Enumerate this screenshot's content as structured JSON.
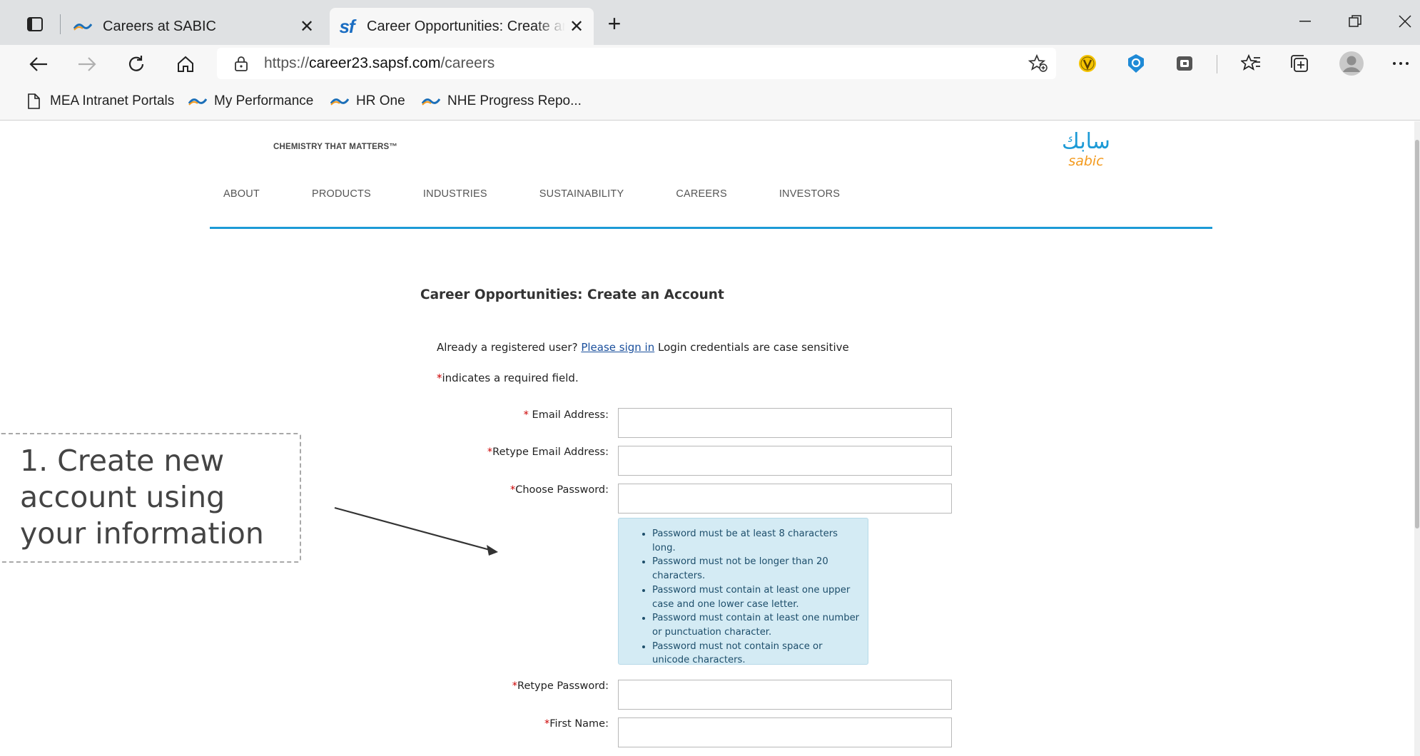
{
  "browser": {
    "tabs": [
      {
        "title": "Careers at SABIC",
        "active": false
      },
      {
        "title": "Career Opportunities: Create an Account",
        "active": true,
        "favicon_text": "sf"
      }
    ],
    "new_tab_label": "+",
    "close_label": "✕",
    "address": {
      "scheme": "https://",
      "host": "career23.sapsf.com",
      "path": "/careers"
    },
    "bookmarks": [
      {
        "label": "MEA Intranet Portals",
        "icon": "page-icon"
      },
      {
        "label": "My Performance",
        "icon": "sabic-wave-icon"
      },
      {
        "label": "HR One",
        "icon": "sabic-wave-icon"
      },
      {
        "label": "NHE Progress Repo...",
        "icon": "sabic-wave-icon"
      }
    ],
    "extension_colors": {
      "v": "#f5c400",
      "shield": "#1f8ad6",
      "puzzle": "#555555"
    }
  },
  "site": {
    "tagline": "CHEMISTRY THAT MATTERS™",
    "logo": {
      "arabic": "سابك",
      "latin": "sabic",
      "color_primary": "#1c9ad6",
      "color_secondary": "#f39a1e"
    },
    "nav": [
      "ABOUT",
      "PRODUCTS",
      "INDUSTRIES",
      "SUSTAINABILITY",
      "CAREERS",
      "INVESTORS"
    ],
    "accent_color": "#1c9ad6"
  },
  "form": {
    "title": "Career Opportunities: Create an Account",
    "intro_prefix": "Already a registered user?",
    "sign_in_link": "Please sign in",
    "intro_suffix": "Login credentials are case sensitive",
    "required_star": "*",
    "required_note": "indicates a required field.",
    "fields": {
      "email": {
        "label": "* Email Address:",
        "value": ""
      },
      "retype_email": {
        "label": "*Retype Email Address:",
        "value": ""
      },
      "password": {
        "label": "*Choose Password:",
        "value": ""
      },
      "retype_password": {
        "label": "*Retype Password:",
        "value": ""
      },
      "first_name": {
        "label": "*First Name:",
        "value": ""
      }
    },
    "password_rules": [
      "Password must be at least 8 characters long.",
      "Password must not be longer than 20 characters.",
      "Password must contain at least one upper case and one lower case letter.",
      "Password must contain at least one number or punctuation character.",
      "Password must not contain space or unicode characters."
    ]
  },
  "annotation": {
    "text": "1. Create new account using your information"
  }
}
